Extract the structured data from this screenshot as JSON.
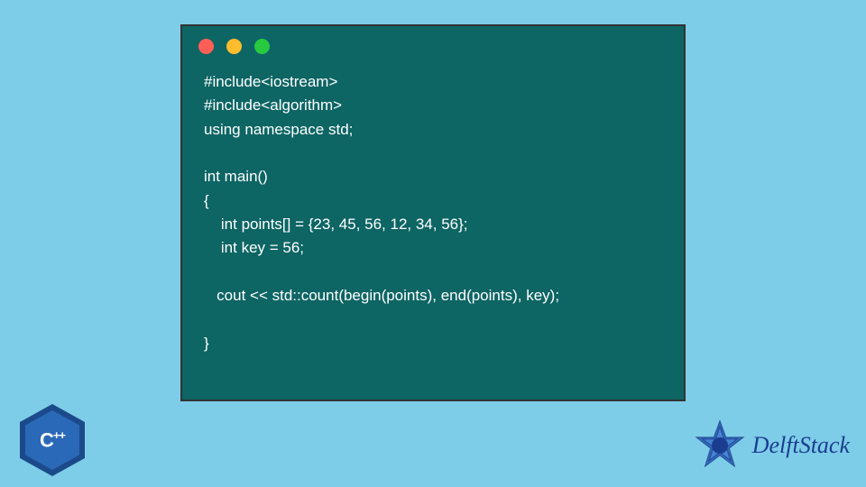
{
  "code": {
    "line1": "#include<iostream>",
    "line2": "#include<algorithm>",
    "line3": "using namespace std;",
    "line4": "",
    "line5": "int main()",
    "line6": "{",
    "line7": "    int points[] = {23, 45, 56, 12, 34, 56};",
    "line8": "    int key = 56;",
    "line9": "",
    "line10": "   cout << std::count(begin(points), end(points), key);",
    "line11": "",
    "line12": "}"
  },
  "badges": {
    "cpp_label": "C",
    "cpp_suffix": "++",
    "delft_label": "DelftStack"
  },
  "colors": {
    "background": "#7ecde8",
    "code_bg": "#0d6564",
    "code_text": "#ffffff",
    "dot_red": "#ff5f56",
    "dot_yellow": "#ffbd2e",
    "dot_green": "#27c93f",
    "cpp_badge": "#2a69b8",
    "delft_accent": "#1a3d8f"
  }
}
